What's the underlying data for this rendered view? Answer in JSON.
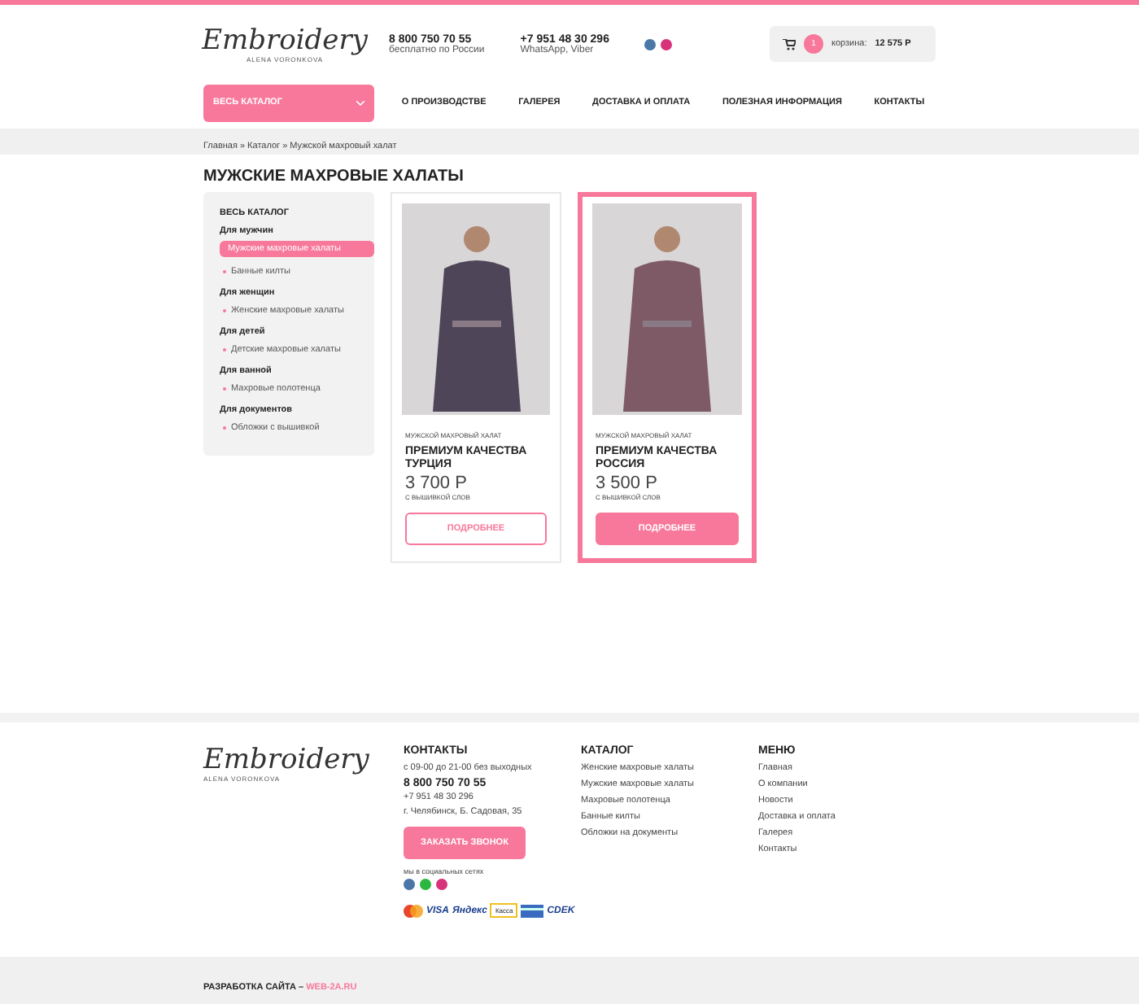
{
  "header": {
    "logo": {
      "script": "Embroidery",
      "name": "ALENA VORONKOVA"
    },
    "phones": [
      {
        "number": "8 800 750 70 55",
        "note": "бесплатно по России"
      },
      {
        "number": "+7 951 48 30 296",
        "note": "WhatsApp, Viber"
      }
    ],
    "cart": {
      "count": "1",
      "label": "корзина:",
      "total": "12 575 Р"
    }
  },
  "nav": {
    "catalog_button": "ВЕСЬ КАТАЛОГ",
    "items": [
      "О ПРОИЗВОДСТВЕ",
      "ГАЛЕРЕЯ",
      "ДОСТАВКА И ОПЛАТА",
      "ПОЛЕЗНАЯ ИНФОРМАЦИЯ",
      "КОНТАКТЫ"
    ]
  },
  "breadcrumb": "Главная » Каталог » Мужской махровый халат",
  "page_title": "МУЖСКИЕ МАХРОВЫЕ ХАЛАТЫ",
  "sidebar": {
    "title": "ВЕСЬ КАТАЛОГ",
    "groups": [
      {
        "title": "Для мужчин",
        "items": [
          {
            "label": "Мужские махровые халаты",
            "selected": true
          },
          {
            "label": "Банные килты",
            "selected": false
          }
        ]
      },
      {
        "title": "Для женщин",
        "items": [
          {
            "label": "Женские махровые халаты",
            "selected": false
          }
        ]
      },
      {
        "title": "Для детей",
        "items": [
          {
            "label": "Детские махровые халаты",
            "selected": false
          }
        ]
      },
      {
        "title": "Для ванной",
        "items": [
          {
            "label": "Махровые полотенца",
            "selected": false
          }
        ]
      },
      {
        "title": "Для документов",
        "items": [
          {
            "label": "Обложки с вышивкой",
            "selected": false
          }
        ]
      }
    ]
  },
  "products": [
    {
      "category": "МУЖСКОЙ МАХРОВЫЙ ХАЛАТ",
      "title": "ПРЕМИУМ КАЧЕСТВА ТУРЦИЯ",
      "price": "3 700 Р",
      "note": "С ВЫШИВКОЙ СЛОВ",
      "button": "ПОДРОБНЕЕ",
      "selected": false
    },
    {
      "category": "МУЖСКОЙ МАХРОВЫЙ ХАЛАТ",
      "title": "ПРЕМИУМ КАЧЕСТВА РОССИЯ",
      "price": "3 500 Р",
      "note": "С ВЫШИВКОЙ СЛОВ",
      "button": "ПОДРОБНЕЕ",
      "selected": true
    }
  ],
  "footer": {
    "logo": {
      "script": "Embroidery",
      "name": "ALENA VORONKOVA"
    },
    "contacts": {
      "title": "КОНТАКТЫ",
      "hours": "с 09-00 до 21-00 без выходных",
      "phone": "8 800 750 70 55",
      "phone2": "+7 951 48 30 296",
      "address": "г. Челябинск, Б. Садовая, 35",
      "button": "ЗАКАЗАТЬ ЗВОНОК",
      "social_label": "мы в социальных сетях",
      "payments": [
        {
          "kind": "mastercard"
        },
        {
          "kind": "text",
          "label": "VISA"
        },
        {
          "kind": "text",
          "label": "Яндекс"
        },
        {
          "kind": "boxed",
          "label": "Касса"
        },
        {
          "kind": "card"
        },
        {
          "kind": "text",
          "label": "CDEK"
        }
      ]
    },
    "catalog": {
      "title": "КАТАЛОГ",
      "links": [
        "Женские махровые халаты",
        "Мужские махровые халаты",
        "Махровые полотенца",
        "Банные килты",
        "Обложки на документы"
      ]
    },
    "menu": {
      "title": "МЕНЮ",
      "links": [
        "Главная",
        "О компании",
        "Новости",
        "Доставка и оплата",
        "Галерея",
        "Контакты"
      ]
    },
    "credit": {
      "label": "РАЗРАБОТКА САЙТА –",
      "link": "WEB-2A.RU"
    }
  }
}
